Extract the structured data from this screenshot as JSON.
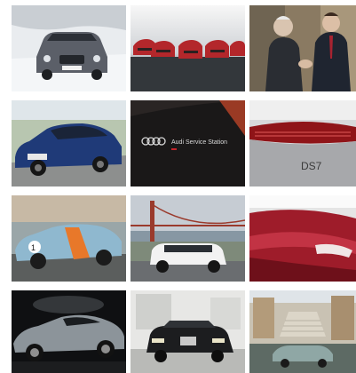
{
  "gallery": {
    "tiles": [
      {
        "alt": "Dark SUV on a snowy road"
      },
      {
        "alt": "Row of red cars in a showroom"
      },
      {
        "alt": "Two men in suits shaking hands"
      },
      {
        "alt": "Blue hatchback driving on a road"
      },
      {
        "alt": "Audi Service Station sign on a black panel"
      },
      {
        "alt": "Red car grille close-up"
      },
      {
        "alt": "Aston Martin in Gulf livery"
      },
      {
        "alt": "White MINI in front of the Golden Gate Bridge"
      },
      {
        "alt": "Red car front detail"
      },
      {
        "alt": "Silver sports car in a dark studio"
      },
      {
        "alt": "Black classic Mercedes in a showroom"
      },
      {
        "alt": "Cars on a city square with stairs"
      }
    ],
    "sign_text": "Audi Service Station",
    "badge_text": "DS7"
  }
}
